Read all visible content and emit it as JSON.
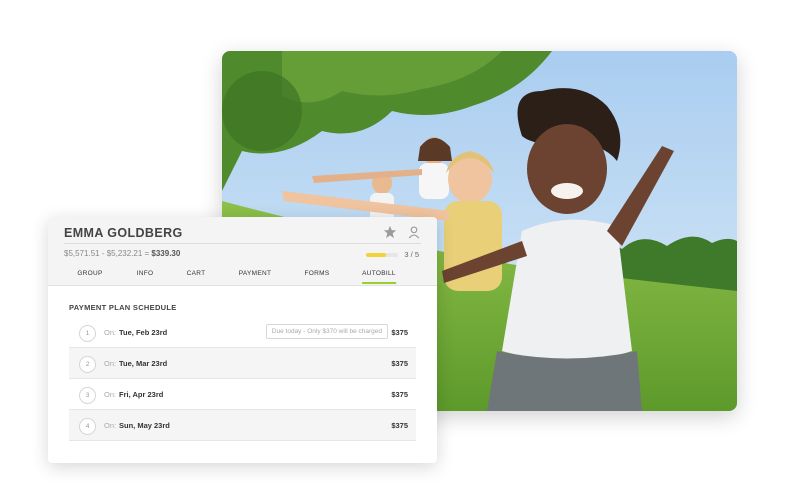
{
  "customer": {
    "name": "EMMA GOLDBERG",
    "balance_calc": "$5,571.51 - $5,232.21 = ",
    "balance_result": "$339.30",
    "progress": {
      "fraction": 0.6,
      "label": "3 / 5"
    }
  },
  "icons": {
    "favorite": "star-icon",
    "profile": "user-icon"
  },
  "tabs": [
    {
      "label": "GROUP"
    },
    {
      "label": "INFO"
    },
    {
      "label": "CART"
    },
    {
      "label": "PAYMENT"
    },
    {
      "label": "FORMS"
    },
    {
      "label": "AUTOBILL",
      "active": true
    }
  ],
  "schedule": {
    "title": "PAYMENT PLAN SCHEDULE",
    "on_label": "On:",
    "rows": [
      {
        "num": "1",
        "date": "Tue, Feb 23rd",
        "note": "Due today - Only $370 will be charged",
        "amount": "$375"
      },
      {
        "num": "2",
        "date": "Tue, Mar 23rd",
        "amount": "$375"
      },
      {
        "num": "3",
        "date": "Fri, Apr 23rd",
        "amount": "$375"
      },
      {
        "num": "4",
        "date": "Sun, May 23rd",
        "amount": "$375"
      }
    ]
  },
  "colors": {
    "accent_green": "#9acd32",
    "progress_yellow": "#f2d23b"
  }
}
